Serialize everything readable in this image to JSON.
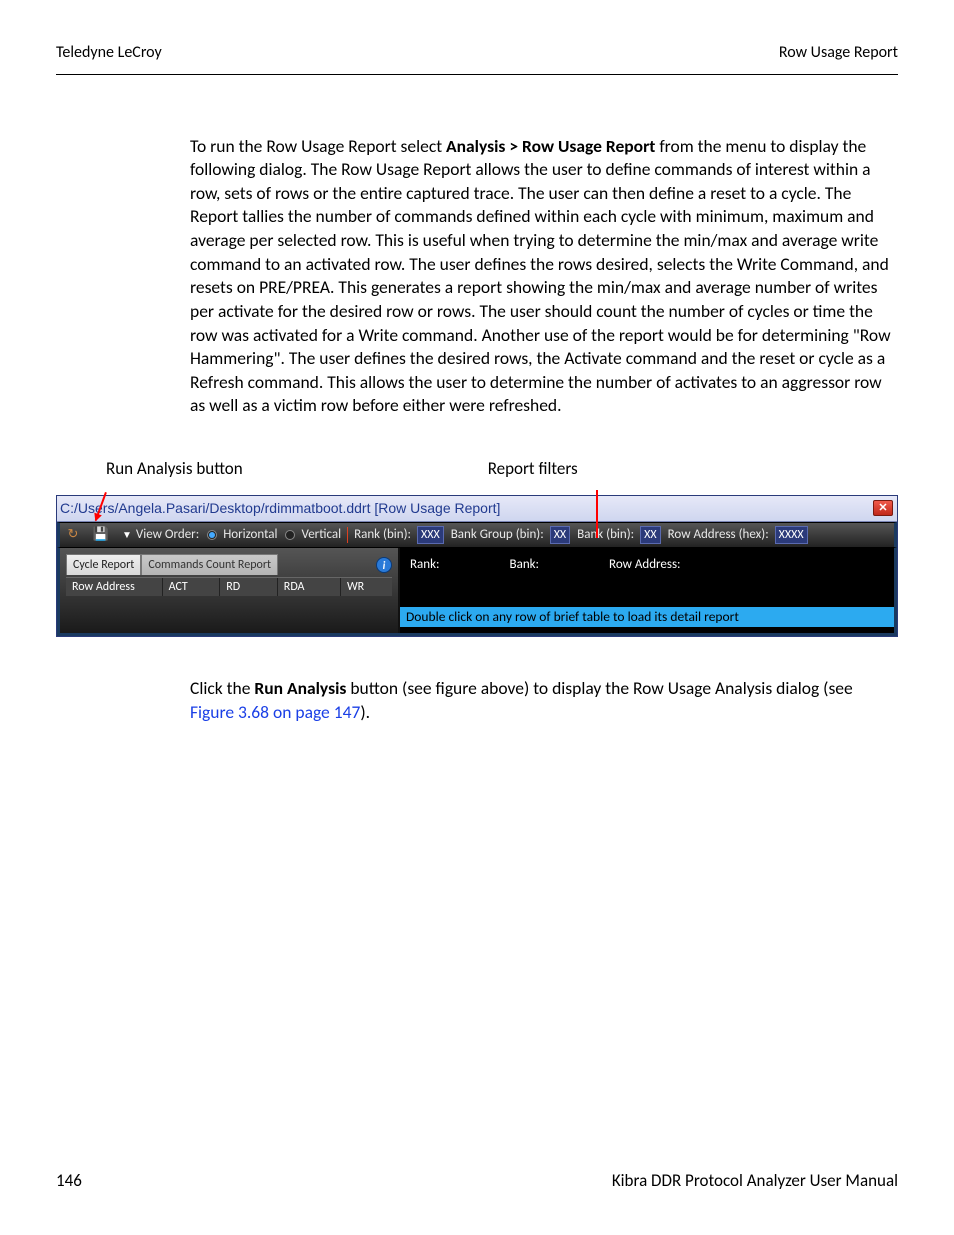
{
  "header": {
    "left": "Teledyne LeCroy",
    "right": "Row Usage Report"
  },
  "para1_a": "To run the Row Usage Report select ",
  "para1_bold": "Analysis > Row Usage Report",
  "para1_b": " from the menu to display the following dialog. The Row Usage Report allows the user to define commands of interest within a row, sets of rows or the entire captured trace. The user can then define a reset to a cycle. The Report tallies the number of commands defined within each cycle with minimum, maximum and average per selected row. This is useful when trying to determine the min/max and average write command to an activated row. The user defines the rows desired, selects the Write Command, and resets on PRE/PREA. This generates a report showing the min/max and average number of writes per activate for the desired row or rows. The user should count the number of cycles or time the row was activated for a Write command. Another use of the report would be for determining \"Row Hammering\". The user defines the desired rows, the Activate command and the reset or cycle as a Refresh command. This allows the user to determine the number of activates to an aggressor row as well as a victim row before either were refreshed.",
  "annotations": {
    "run": "Run Analysis button",
    "filters": "Report filters"
  },
  "window": {
    "title": "C:/Users/Angela.Pasari/Desktop/rdimmatboot.ddrt [Row Usage Report]",
    "view_order_label": "View Order:",
    "horizontal": "Horizontal",
    "vertical": "Vertical",
    "rank_label": "Rank (bin):",
    "rank_val": "XXX",
    "bankgroup_label": "Bank Group (bin):",
    "bankgroup_val": "XX",
    "bank_label": "Bank (bin):",
    "bank_val": "XX",
    "rowaddr_label": "Row Address (hex):",
    "rowaddr_val": "XXXX",
    "tabs": {
      "active": "Cycle Report",
      "inactive": "Commands Count Report"
    },
    "cols": [
      "Row Address",
      "ACT",
      "RD",
      "RDA",
      "WR"
    ],
    "right_hdrs": {
      "rank": "Rank:",
      "bank": "Bank:",
      "rowaddr": "Row Address:"
    },
    "hint": "Double click on any row of brief table to load its detail report"
  },
  "lower_a": "Click the ",
  "lower_bold": "Run Analysis",
  "lower_b": " button (see figure above) to display the Row Usage Analysis dialog (see ",
  "lower_link": "Figure 3.68 on page 147",
  "lower_c": ").",
  "footer": {
    "page": "146",
    "manual": "Kibra DDR Protocol Analyzer User Manual"
  }
}
